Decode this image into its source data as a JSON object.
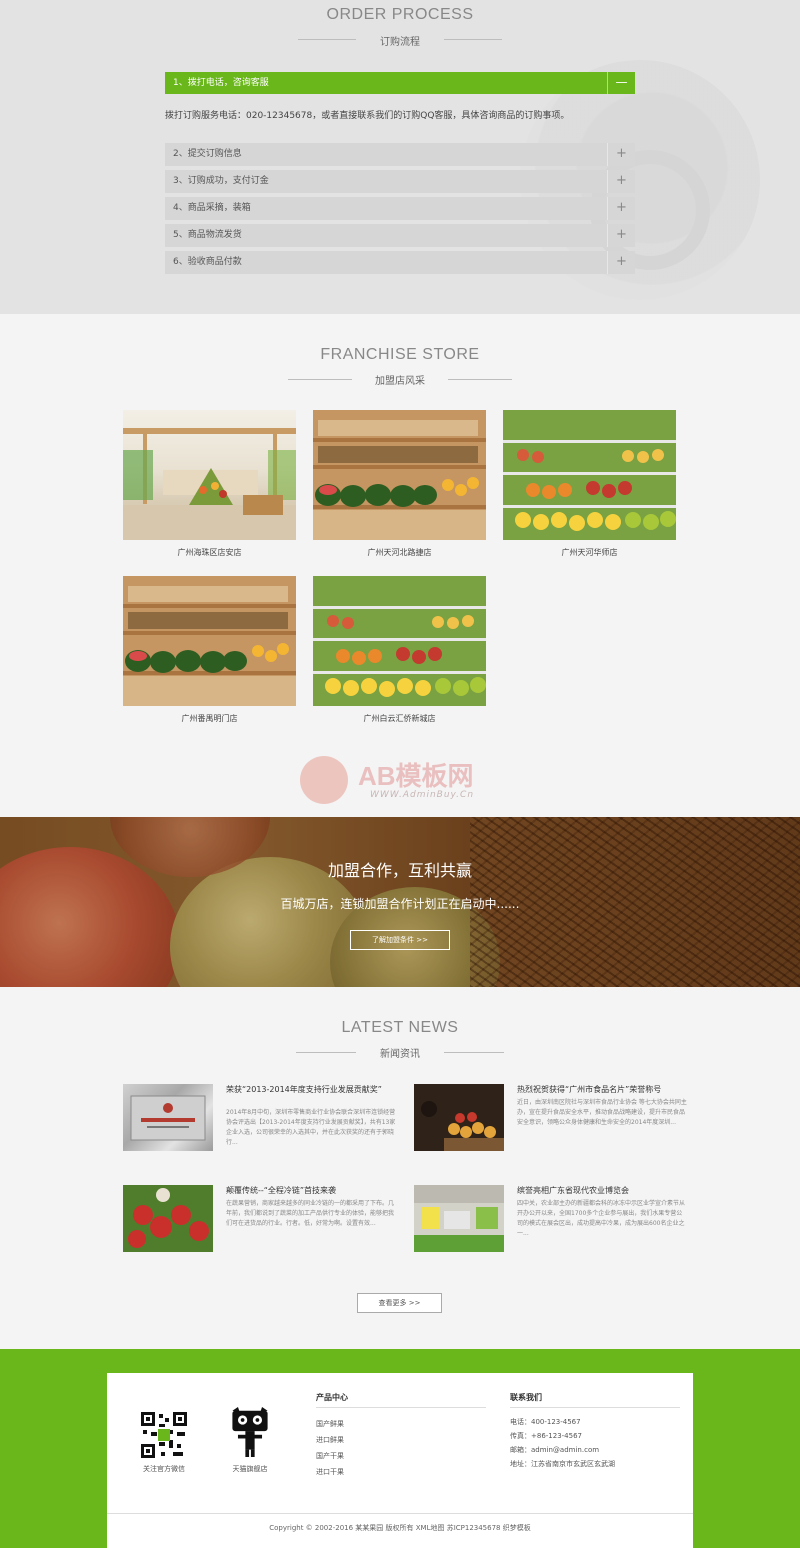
{
  "order": {
    "title": "ORDER PROCESS",
    "subtitle": "订购流程",
    "active_item": "1、拨打电话，咨询客服",
    "active_toggle": "—",
    "description": "拨打订购服务电话：020-12345678，或者直接联系我们的订购QQ客服，具体咨询商品的订购事项。",
    "items": [
      {
        "label": "2、提交订购信息",
        "toggle": "+"
      },
      {
        "label": "3、订购成功，支付订金",
        "toggle": "+"
      },
      {
        "label": "4、商品采摘，装箱",
        "toggle": "+"
      },
      {
        "label": "5、商品物流发货",
        "toggle": "+"
      },
      {
        "label": "6、验收商品付款",
        "toggle": "+"
      }
    ]
  },
  "franchise": {
    "title": "FRANCHISE STORE",
    "subtitle": "加盟店风采",
    "stores": [
      {
        "caption": "广州海珠区店安店"
      },
      {
        "caption": "广州天河北路捷店"
      },
      {
        "caption": "广州天河华师店"
      },
      {
        "caption": "广州番禺明门店"
      },
      {
        "caption": "广州白云汇侨新城店"
      }
    ],
    "watermark": {
      "brand": "AB模板网",
      "url": "WWW.AdminBuy.Cn"
    }
  },
  "banner": {
    "headline": "加盟合作，互利共赢",
    "tagline": "百城万店，连锁加盟合作计划正在启动中......",
    "button": "了解加盟条件 >>"
  },
  "news": {
    "title": "LATEST NEWS",
    "subtitle": "新闻资讯",
    "items": [
      {
        "title": "荣获“2013-2014年度支持行业发展贡献奖”",
        "summary": "2014年8月中旬，深圳市零售商业行业协会联合深圳市连锁经营协会评选出【2013-2014年度支持行业发展贡献奖】，共有13家企业入选，公司很荣幸的入选其中，并在此次获奖的还有于郭晓行..."
      },
      {
        "title": "热烈祝贺获得“广州市食品名片”荣誉称号",
        "summary": "近日，由深圳南区院社与深圳市食品行业协会 等七大协会共同主办，宣在提升食品安全水平，推动食品战略建设，提升市民食品安全意识，领略公众身体健康和生命安全的2014年度深圳..."
      },
      {
        "title": "颠覆传统--“全程冷链”首技来袭",
        "summary": "在蔬果营销，商家越来越多的同业冷链的一的都采用了下布。几年前，我们都说到了蔬菜的加工产品供行专业的体验，能够把我们可在进货品的行业。行者。低，好常为啊。设置有效..."
      },
      {
        "title": "缤誉亮相广东省现代农业博览会",
        "summary": "四中关，农业部主办的新疆都会科的冰冻中示区业学宣介素节从开办公开以来，全国1700多个企业参与展出，我们水果专营公司的模式在展会区出，成功提高中冷果，成为展出600名企业之一..."
      }
    ],
    "more_button": "查看更多 >>"
  },
  "footer": {
    "qr1_caption": "关注官方微信",
    "qr2_caption": "天猫旗舰店",
    "products_title": "产品中心",
    "products": [
      "国产鲜果",
      "进口鲜果",
      "国产干果",
      "进口干果"
    ],
    "contact_title": "联系我们",
    "contact": [
      "电话：400-123-4567",
      "传真：+86-123-4567",
      "邮箱：admin@admin.com",
      "地址：江苏省南京市玄武区玄武湖"
    ],
    "copyright": "Copyright © 2002-2016 某某果园 版权所有  XML地图  苏ICP12345678  织梦模板"
  },
  "colors": {
    "accent": "#6ab71b",
    "order_bg": "#e3e3e3",
    "page_bg": "#f4f4f4"
  }
}
